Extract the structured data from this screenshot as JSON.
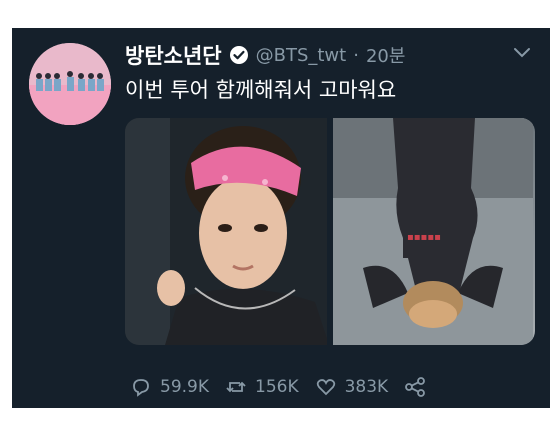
{
  "tweet": {
    "display_name": "방탄소년단",
    "handle": "@BTS_twt",
    "separator": "·",
    "time": "20분",
    "text": "이번 투어 함께해줘서 고마워요",
    "icons": {
      "verified": "verified-badge-icon",
      "menu": "chevron-down-icon",
      "reply": "reply-icon",
      "retweet": "retweet-icon",
      "like": "heart-icon",
      "share": "share-icon"
    }
  },
  "actions": {
    "replies": "59.9K",
    "retweets": "156K",
    "likes": "383K"
  },
  "colors": {
    "background": "#15202b",
    "muted": "#8899a6",
    "headband": "#e56fa0",
    "verified": "#ffffff"
  }
}
